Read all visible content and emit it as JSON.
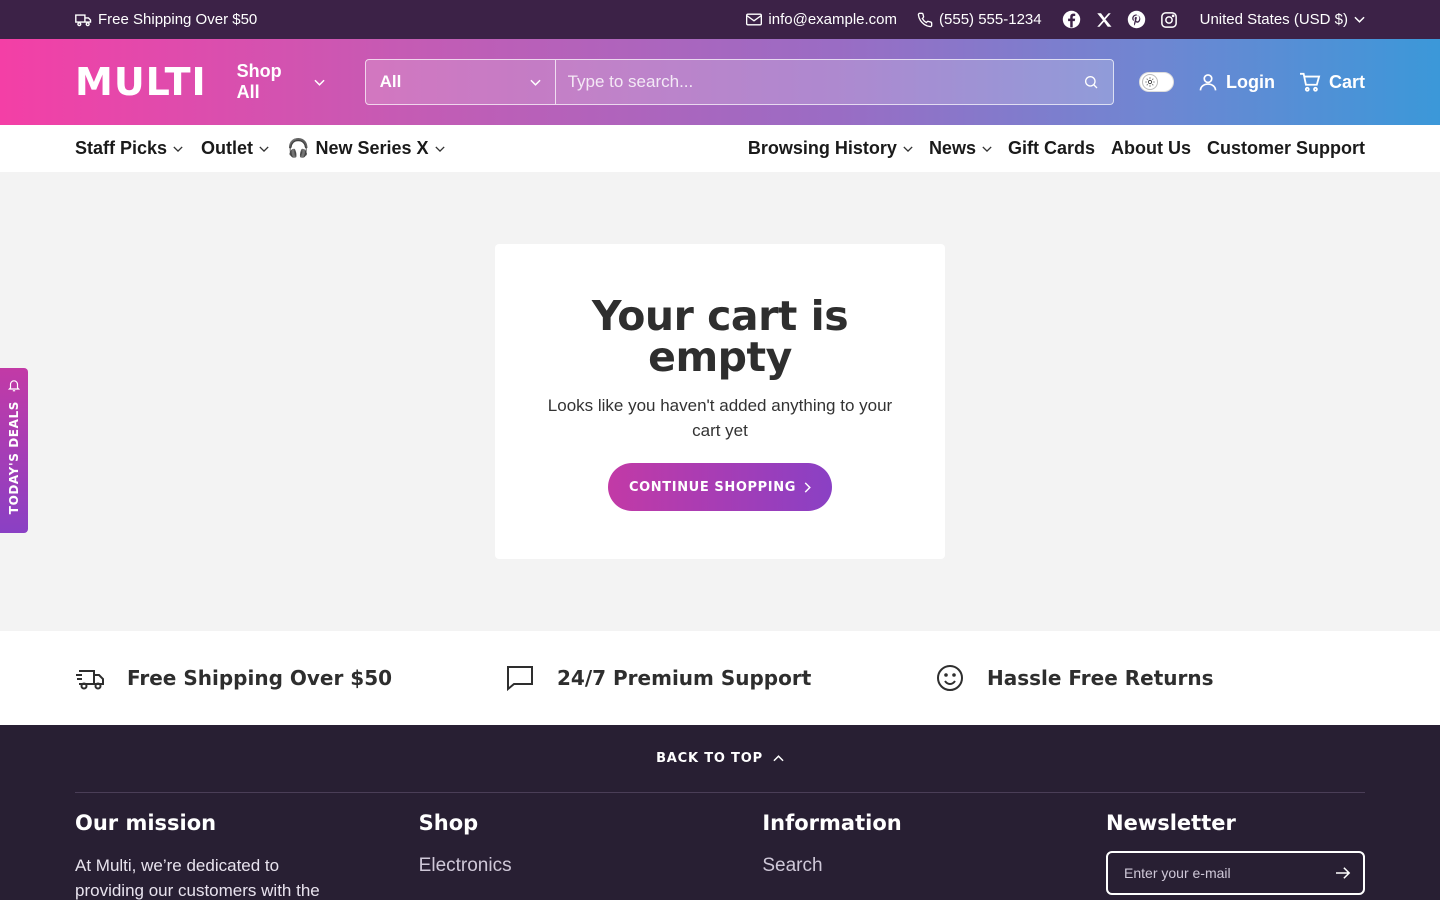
{
  "topbar": {
    "shipping": "Free Shipping Over $50",
    "email": "info@example.com",
    "phone": "(555) 555-1234",
    "socials": [
      "facebook-icon",
      "x-icon",
      "pinterest-icon",
      "instagram-icon"
    ],
    "currency": "United States (USD $)"
  },
  "header": {
    "logo": "MULTI",
    "shop_all": "Shop All",
    "search_category": "All",
    "search_placeholder": "Type to search...",
    "login": "Login",
    "cart": "Cart"
  },
  "nav": {
    "left": [
      "Staff Picks",
      "Outlet",
      "New Series X"
    ],
    "new_series_icon": "🎧",
    "right": [
      "Browsing History",
      "News",
      "Gift Cards",
      "About Us",
      "Customer Support"
    ]
  },
  "cart": {
    "title": "Your cart is empty",
    "message": "Looks like you haven't added anything to your cart yet",
    "cta": "CONTINUE SHOPPING"
  },
  "side_tab": {
    "label": "TODAY'S DEALS"
  },
  "features": [
    {
      "icon": "truck-icon",
      "label": "Free Shipping Over $50"
    },
    {
      "icon": "chat-icon",
      "label": "24/7 Premium Support"
    },
    {
      "icon": "smile-icon",
      "label": "Hassle Free Returns"
    }
  ],
  "footer": {
    "back_to_top": "BACK TO TOP",
    "mission_title": "Our mission",
    "mission_text": "At Multi, we’re dedicated to providing our customers with the",
    "shop_title": "Shop",
    "shop_link": "Electronics",
    "info_title": "Information",
    "info_link": "Search",
    "newsletter_title": "Newsletter",
    "newsletter_placeholder": "Enter your e-mail"
  },
  "colors": {
    "topbar": "#3c2247",
    "header_gradient_start": "#f43fa6",
    "header_gradient_end": "#3b98d9",
    "cta_start": "#c23aa6",
    "cta_end": "#8a40c4",
    "footer": "#281f33"
  }
}
